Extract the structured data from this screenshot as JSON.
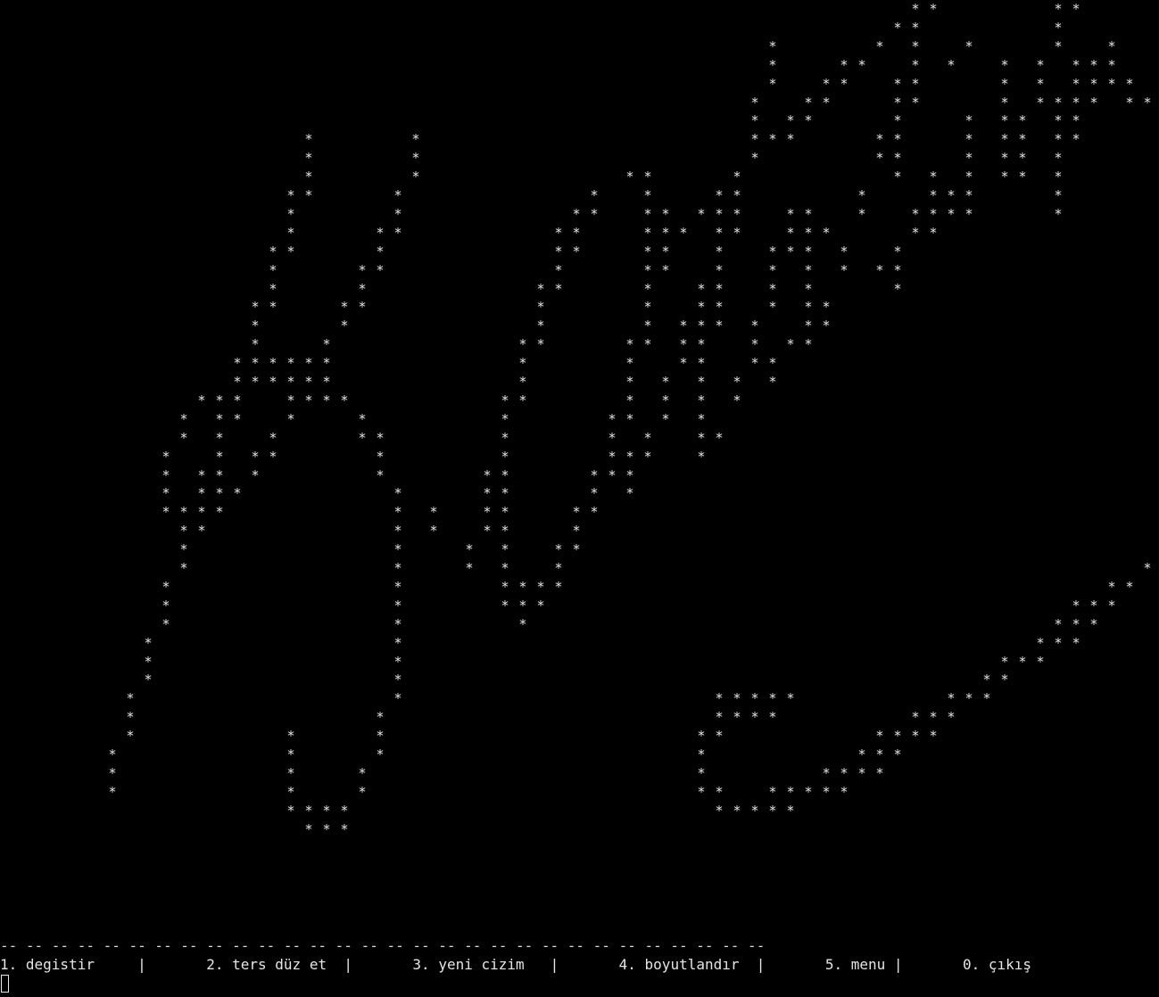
{
  "terminal": {
    "separator": "-- -- -- -- -- -- -- -- -- -- -- -- -- -- -- -- -- -- -- -- -- -- -- -- -- -- -- -- -- --",
    "menu": {
      "item_1": "1. degistir",
      "item_2": "2. ters düz et",
      "item_3": "3. yeni cizim",
      "item_4": "4. boyutlandır",
      "item_5": "5. menu",
      "item_0": "0. çıkış",
      "divider": "|"
    },
    "art_glyph": "*",
    "art_rows": [
      "                                                ** ",
      "                                               **      ",
      "                                       *      *   *    *          ",
      "                                       *    **    *   *   *  *  ***",
      "                                       *   **   **       *  * ****",
      "                                      * **     **       * ****   **",
      "                                      * **     *    *   ** **     *",
      "                                      ***     **    *   ** **       *",
      "                                      *       **    *   ** *         **",
      "                                            *  * *  *** *           *"
    ],
    "art_points": [
      [
        48,
        0
      ],
      [
        49,
        0
      ],
      [
        56,
        0
      ],
      [
        57,
        0
      ],
      [
        47,
        1
      ],
      [
        48,
        1
      ],
      [
        56,
        1
      ],
      [
        40,
        2
      ],
      [
        46,
        2
      ],
      [
        48,
        2
      ],
      [
        51,
        2
      ],
      [
        56,
        2
      ],
      [
        59,
        2
      ],
      [
        40,
        3
      ],
      [
        44,
        3
      ],
      [
        45,
        3
      ],
      [
        48,
        3
      ],
      [
        50,
        3
      ],
      [
        53,
        3
      ],
      [
        55,
        3
      ],
      [
        57,
        3
      ],
      [
        58,
        3
      ],
      [
        59,
        3
      ],
      [
        40,
        4
      ],
      [
        43,
        4
      ],
      [
        44,
        4
      ],
      [
        47,
        4
      ],
      [
        48,
        4
      ],
      [
        53,
        4
      ],
      [
        55,
        4
      ],
      [
        57,
        4
      ],
      [
        58,
        4
      ],
      [
        59,
        4
      ],
      [
        60,
        4
      ],
      [
        39,
        5
      ],
      [
        42,
        5
      ],
      [
        43,
        5
      ],
      [
        47,
        5
      ],
      [
        48,
        5
      ],
      [
        53,
        5
      ],
      [
        55,
        5
      ],
      [
        56,
        5
      ],
      [
        57,
        5
      ],
      [
        58,
        5
      ],
      [
        60,
        5
      ],
      [
        61,
        5
      ],
      [
        39,
        6
      ],
      [
        41,
        6
      ],
      [
        42,
        6
      ],
      [
        47,
        6
      ],
      [
        51,
        6
      ],
      [
        53,
        6
      ],
      [
        54,
        6
      ],
      [
        56,
        6
      ],
      [
        57,
        6
      ],
      [
        62,
        6
      ],
      [
        14,
        7
      ],
      [
        20,
        7
      ],
      [
        39,
        7
      ],
      [
        40,
        7
      ],
      [
        41,
        7
      ],
      [
        46,
        7
      ],
      [
        47,
        7
      ],
      [
        51,
        7
      ],
      [
        53,
        7
      ],
      [
        54,
        7
      ],
      [
        56,
        7
      ],
      [
        57,
        7
      ],
      [
        63,
        7
      ],
      [
        14,
        8
      ],
      [
        20,
        8
      ],
      [
        39,
        8
      ],
      [
        46,
        8
      ],
      [
        47,
        8
      ],
      [
        51,
        8
      ],
      [
        53,
        8
      ],
      [
        54,
        8
      ],
      [
        56,
        8
      ],
      [
        63,
        8
      ],
      [
        64,
        8
      ],
      [
        14,
        9
      ],
      [
        20,
        9
      ],
      [
        32,
        9
      ],
      [
        33,
        9
      ],
      [
        38,
        9
      ],
      [
        47,
        9
      ],
      [
        49,
        9
      ],
      [
        51,
        9
      ],
      [
        53,
        9
      ],
      [
        54,
        9
      ],
      [
        56,
        9
      ],
      [
        64,
        9
      ],
      [
        13,
        10
      ],
      [
        14,
        10
      ],
      [
        19,
        10
      ],
      [
        30,
        10
      ],
      [
        33,
        10
      ],
      [
        37,
        10
      ],
      [
        38,
        10
      ],
      [
        45,
        10
      ],
      [
        49,
        10
      ],
      [
        50,
        10
      ],
      [
        51,
        10
      ],
      [
        56,
        10
      ],
      [
        13,
        11
      ],
      [
        19,
        11
      ],
      [
        29,
        11
      ],
      [
        30,
        11
      ],
      [
        33,
        11
      ],
      [
        34,
        11
      ],
      [
        36,
        11
      ],
      [
        37,
        11
      ],
      [
        38,
        11
      ],
      [
        41,
        11
      ],
      [
        42,
        11
      ],
      [
        45,
        11
      ],
      [
        48,
        11
      ],
      [
        49,
        11
      ],
      [
        50,
        11
      ],
      [
        51,
        11
      ],
      [
        56,
        11
      ],
      [
        13,
        12
      ],
      [
        18,
        12
      ],
      [
        19,
        12
      ],
      [
        28,
        12
      ],
      [
        29,
        12
      ],
      [
        33,
        12
      ],
      [
        34,
        12
      ],
      [
        35,
        12
      ],
      [
        37,
        12
      ],
      [
        38,
        12
      ],
      [
        41,
        12
      ],
      [
        42,
        12
      ],
      [
        43,
        12
      ],
      [
        48,
        12
      ],
      [
        49,
        12
      ],
      [
        12,
        13
      ],
      [
        13,
        13
      ],
      [
        18,
        13
      ],
      [
        28,
        13
      ],
      [
        29,
        13
      ],
      [
        33,
        13
      ],
      [
        34,
        13
      ],
      [
        37,
        13
      ],
      [
        40,
        13
      ],
      [
        41,
        13
      ],
      [
        42,
        13
      ],
      [
        44,
        13
      ],
      [
        47,
        13
      ],
      [
        12,
        14
      ],
      [
        17,
        14
      ],
      [
        18,
        14
      ],
      [
        28,
        14
      ],
      [
        33,
        14
      ],
      [
        34,
        14
      ],
      [
        37,
        14
      ],
      [
        40,
        14
      ],
      [
        42,
        14
      ],
      [
        44,
        14
      ],
      [
        46,
        14
      ],
      [
        47,
        14
      ],
      [
        12,
        15
      ],
      [
        17,
        15
      ],
      [
        27,
        15
      ],
      [
        28,
        15
      ],
      [
        33,
        15
      ],
      [
        36,
        15
      ],
      [
        37,
        15
      ],
      [
        40,
        15
      ],
      [
        42,
        15
      ],
      [
        47,
        15
      ],
      [
        11,
        16
      ],
      [
        12,
        16
      ],
      [
        16,
        16
      ],
      [
        17,
        16
      ],
      [
        27,
        16
      ],
      [
        33,
        16
      ],
      [
        36,
        16
      ],
      [
        37,
        16
      ],
      [
        40,
        16
      ],
      [
        42,
        16
      ],
      [
        43,
        16
      ],
      [
        11,
        17
      ],
      [
        16,
        17
      ],
      [
        27,
        17
      ],
      [
        33,
        17
      ],
      [
        35,
        17
      ],
      [
        36,
        17
      ],
      [
        37,
        17
      ],
      [
        39,
        17
      ],
      [
        42,
        17
      ],
      [
        43,
        17
      ],
      [
        11,
        18
      ],
      [
        15,
        18
      ],
      [
        26,
        18
      ],
      [
        27,
        18
      ],
      [
        32,
        18
      ],
      [
        33,
        18
      ],
      [
        35,
        18
      ],
      [
        36,
        18
      ],
      [
        39,
        18
      ],
      [
        41,
        18
      ],
      [
        42,
        18
      ],
      [
        10,
        19
      ],
      [
        11,
        19
      ],
      [
        12,
        19
      ],
      [
        13,
        19
      ],
      [
        14,
        19
      ],
      [
        15,
        19
      ],
      [
        26,
        19
      ],
      [
        32,
        19
      ],
      [
        35,
        19
      ],
      [
        36,
        19
      ],
      [
        39,
        19
      ],
      [
        40,
        19
      ],
      [
        10,
        20
      ],
      [
        11,
        20
      ],
      [
        12,
        20
      ],
      [
        13,
        20
      ],
      [
        14,
        20
      ],
      [
        15,
        20
      ],
      [
        26,
        20
      ],
      [
        32,
        20
      ],
      [
        34,
        20
      ],
      [
        36,
        20
      ],
      [
        38,
        20
      ],
      [
        40,
        20
      ],
      [
        8,
        21
      ],
      [
        9,
        21
      ],
      [
        10,
        21
      ],
      [
        13,
        21
      ],
      [
        14,
        21
      ],
      [
        15,
        21
      ],
      [
        16,
        21
      ],
      [
        25,
        21
      ],
      [
        26,
        21
      ],
      [
        32,
        21
      ],
      [
        34,
        21
      ],
      [
        36,
        21
      ],
      [
        38,
        21
      ],
      [
        7,
        22
      ],
      [
        9,
        22
      ],
      [
        10,
        22
      ],
      [
        13,
        22
      ],
      [
        17,
        22
      ],
      [
        25,
        22
      ],
      [
        31,
        22
      ],
      [
        32,
        22
      ],
      [
        34,
        22
      ],
      [
        36,
        22
      ],
      [
        7,
        23
      ],
      [
        9,
        23
      ],
      [
        12,
        23
      ],
      [
        17,
        23
      ],
      [
        18,
        23
      ],
      [
        25,
        23
      ],
      [
        31,
        23
      ],
      [
        33,
        23
      ],
      [
        36,
        23
      ],
      [
        37,
        23
      ],
      [
        6,
        24
      ],
      [
        9,
        24
      ],
      [
        11,
        24
      ],
      [
        12,
        24
      ],
      [
        18,
        24
      ],
      [
        25,
        24
      ],
      [
        31,
        24
      ],
      [
        32,
        24
      ],
      [
        33,
        24
      ],
      [
        36,
        24
      ],
      [
        6,
        25
      ],
      [
        8,
        25
      ],
      [
        9,
        25
      ],
      [
        11,
        25
      ],
      [
        18,
        25
      ],
      [
        24,
        25
      ],
      [
        25,
        25
      ],
      [
        30,
        25
      ],
      [
        31,
        25
      ],
      [
        32,
        25
      ],
      [
        6,
        26
      ],
      [
        8,
        26
      ],
      [
        9,
        26
      ],
      [
        10,
        26
      ],
      [
        19,
        26
      ],
      [
        24,
        26
      ],
      [
        25,
        26
      ],
      [
        30,
        26
      ],
      [
        32,
        26
      ],
      [
        6,
        27
      ],
      [
        7,
        27
      ],
      [
        8,
        27
      ],
      [
        9,
        27
      ],
      [
        19,
        27
      ],
      [
        21,
        27
      ],
      [
        24,
        27
      ],
      [
        25,
        27
      ],
      [
        29,
        27
      ],
      [
        30,
        27
      ],
      [
        64,
        27
      ],
      [
        7,
        28
      ],
      [
        8,
        28
      ],
      [
        19,
        28
      ],
      [
        21,
        28
      ],
      [
        24,
        28
      ],
      [
        25,
        28
      ],
      [
        29,
        28
      ],
      [
        63,
        28
      ],
      [
        7,
        29
      ],
      [
        19,
        29
      ],
      [
        23,
        29
      ],
      [
        25,
        29
      ],
      [
        28,
        29
      ],
      [
        29,
        29
      ],
      [
        62,
        29
      ],
      [
        7,
        30
      ],
      [
        19,
        30
      ],
      [
        23,
        30
      ],
      [
        25,
        30
      ],
      [
        28,
        30
      ],
      [
        61,
        30
      ],
      [
        6,
        31
      ],
      [
        19,
        31
      ],
      [
        25,
        31
      ],
      [
        26,
        31
      ],
      [
        27,
        31
      ],
      [
        28,
        31
      ],
      [
        59,
        31
      ],
      [
        60,
        31
      ],
      [
        6,
        32
      ],
      [
        19,
        32
      ],
      [
        25,
        32
      ],
      [
        26,
        32
      ],
      [
        27,
        32
      ],
      [
        57,
        32
      ],
      [
        58,
        32
      ],
      [
        59,
        32
      ],
      [
        6,
        33
      ],
      [
        19,
        33
      ],
      [
        26,
        33
      ],
      [
        56,
        33
      ],
      [
        57,
        33
      ],
      [
        58,
        33
      ],
      [
        5,
        34
      ],
      [
        19,
        34
      ],
      [
        55,
        34
      ],
      [
        56,
        34
      ],
      [
        57,
        34
      ],
      [
        5,
        35
      ],
      [
        19,
        35
      ],
      [
        53,
        35
      ],
      [
        54,
        35
      ],
      [
        55,
        35
      ],
      [
        5,
        36
      ],
      [
        19,
        36
      ],
      [
        52,
        36
      ],
      [
        53,
        36
      ],
      [
        4,
        37
      ],
      [
        19,
        37
      ],
      [
        37,
        37
      ],
      [
        38,
        37
      ],
      [
        39,
        37
      ],
      [
        40,
        37
      ],
      [
        41,
        37
      ],
      [
        50,
        37
      ],
      [
        51,
        37
      ],
      [
        52,
        37
      ],
      [
        4,
        38
      ],
      [
        18,
        38
      ],
      [
        37,
        38
      ],
      [
        38,
        38
      ],
      [
        39,
        38
      ],
      [
        40,
        38
      ],
      [
        48,
        38
      ],
      [
        49,
        38
      ],
      [
        50,
        38
      ],
      [
        4,
        39
      ],
      [
        13,
        39
      ],
      [
        18,
        39
      ],
      [
        36,
        39
      ],
      [
        37,
        39
      ],
      [
        46,
        39
      ],
      [
        47,
        39
      ],
      [
        48,
        39
      ],
      [
        49,
        39
      ],
      [
        3,
        40
      ],
      [
        13,
        40
      ],
      [
        18,
        40
      ],
      [
        36,
        40
      ],
      [
        45,
        40
      ],
      [
        46,
        40
      ],
      [
        47,
        40
      ],
      [
        3,
        41
      ],
      [
        13,
        41
      ],
      [
        17,
        41
      ],
      [
        36,
        41
      ],
      [
        43,
        41
      ],
      [
        44,
        41
      ],
      [
        45,
        41
      ],
      [
        46,
        41
      ],
      [
        3,
        42
      ],
      [
        13,
        42
      ],
      [
        17,
        42
      ],
      [
        36,
        42
      ],
      [
        37,
        42
      ],
      [
        40,
        42
      ],
      [
        41,
        42
      ],
      [
        42,
        42
      ],
      [
        43,
        42
      ],
      [
        44,
        42
      ],
      [
        13,
        43
      ],
      [
        14,
        43
      ],
      [
        15,
        43
      ],
      [
        16,
        43
      ],
      [
        37,
        43
      ],
      [
        38,
        43
      ],
      [
        39,
        43
      ],
      [
        40,
        43
      ],
      [
        41,
        43
      ],
      [
        14,
        44
      ],
      [
        15,
        44
      ],
      [
        16,
        44
      ]
    ]
  }
}
